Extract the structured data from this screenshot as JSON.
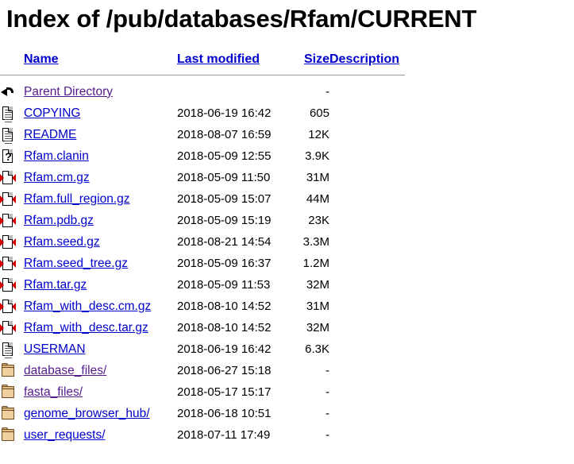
{
  "page": {
    "title": "Index of /pub/databases/Rfam/CURRENT"
  },
  "table": {
    "headers": {
      "name": "Name",
      "last_modified": "Last modified",
      "size": "Size",
      "description": "Description"
    },
    "rows": [
      {
        "icon": "back-icon",
        "name": "Parent Directory",
        "last_modified": "",
        "size": "-",
        "description": "",
        "link_state": "visited"
      },
      {
        "icon": "text-file-icon",
        "name": "COPYING",
        "last_modified": "2018-06-19 16:42",
        "size": "605",
        "description": "",
        "link_state": "unvisited"
      },
      {
        "icon": "text-file-icon",
        "name": "README",
        "last_modified": "2018-08-07 16:59",
        "size": "12K",
        "description": "",
        "link_state": "unvisited"
      },
      {
        "icon": "unknown-file-icon",
        "name": "Rfam.clanin",
        "last_modified": "2018-05-09 12:55",
        "size": "3.9K",
        "description": "",
        "link_state": "unvisited"
      },
      {
        "icon": "compressed-file-icon",
        "name": "Rfam.cm.gz",
        "last_modified": "2018-05-09 11:50",
        "size": "31M",
        "description": "",
        "link_state": "unvisited"
      },
      {
        "icon": "compressed-file-icon",
        "name": "Rfam.full_region.gz",
        "last_modified": "2018-05-09 15:07",
        "size": "44M",
        "description": "",
        "link_state": "unvisited"
      },
      {
        "icon": "compressed-file-icon",
        "name": "Rfam.pdb.gz",
        "last_modified": "2018-05-09 15:19",
        "size": "23K",
        "description": "",
        "link_state": "unvisited"
      },
      {
        "icon": "compressed-file-icon",
        "name": "Rfam.seed.gz",
        "last_modified": "2018-08-21 14:54",
        "size": "3.3M",
        "description": "",
        "link_state": "unvisited"
      },
      {
        "icon": "compressed-file-icon",
        "name": "Rfam.seed_tree.gz",
        "last_modified": "2018-05-09 16:37",
        "size": "1.2M",
        "description": "",
        "link_state": "unvisited"
      },
      {
        "icon": "compressed-file-icon",
        "name": "Rfam.tar.gz",
        "last_modified": "2018-05-09 11:53",
        "size": "32M",
        "description": "",
        "link_state": "unvisited"
      },
      {
        "icon": "compressed-file-icon",
        "name": "Rfam_with_desc.cm.gz",
        "last_modified": "2018-08-10 14:52",
        "size": "31M",
        "description": "",
        "link_state": "unvisited"
      },
      {
        "icon": "compressed-file-icon",
        "name": "Rfam_with_desc.tar.gz",
        "last_modified": "2018-08-10 14:52",
        "size": "32M",
        "description": "",
        "link_state": "unvisited"
      },
      {
        "icon": "text-file-icon",
        "name": "USERMAN",
        "last_modified": "2018-06-19 16:42",
        "size": "6.3K",
        "description": "",
        "link_state": "unvisited"
      },
      {
        "icon": "folder-icon",
        "name": "database_files/",
        "last_modified": "2018-06-27 15:18",
        "size": "-",
        "description": "",
        "link_state": "visited"
      },
      {
        "icon": "folder-icon",
        "name": "fasta_files/",
        "last_modified": "2018-05-17 15:17",
        "size": "-",
        "description": "",
        "link_state": "visited"
      },
      {
        "icon": "folder-icon",
        "name": "genome_browser_hub/",
        "last_modified": "2018-06-18 10:51",
        "size": "-",
        "description": "",
        "link_state": "unvisited"
      },
      {
        "icon": "folder-icon",
        "name": "user_requests/",
        "last_modified": "2018-07-11 17:49",
        "size": "-",
        "description": "",
        "link_state": "unvisited"
      }
    ]
  },
  "colors": {
    "link_unvisited": "#0000cc",
    "link_visited": "#551a8b",
    "rule": "#9a9a9a",
    "folder": "#f0cfa0",
    "compressed_arrow": "#d40000"
  }
}
